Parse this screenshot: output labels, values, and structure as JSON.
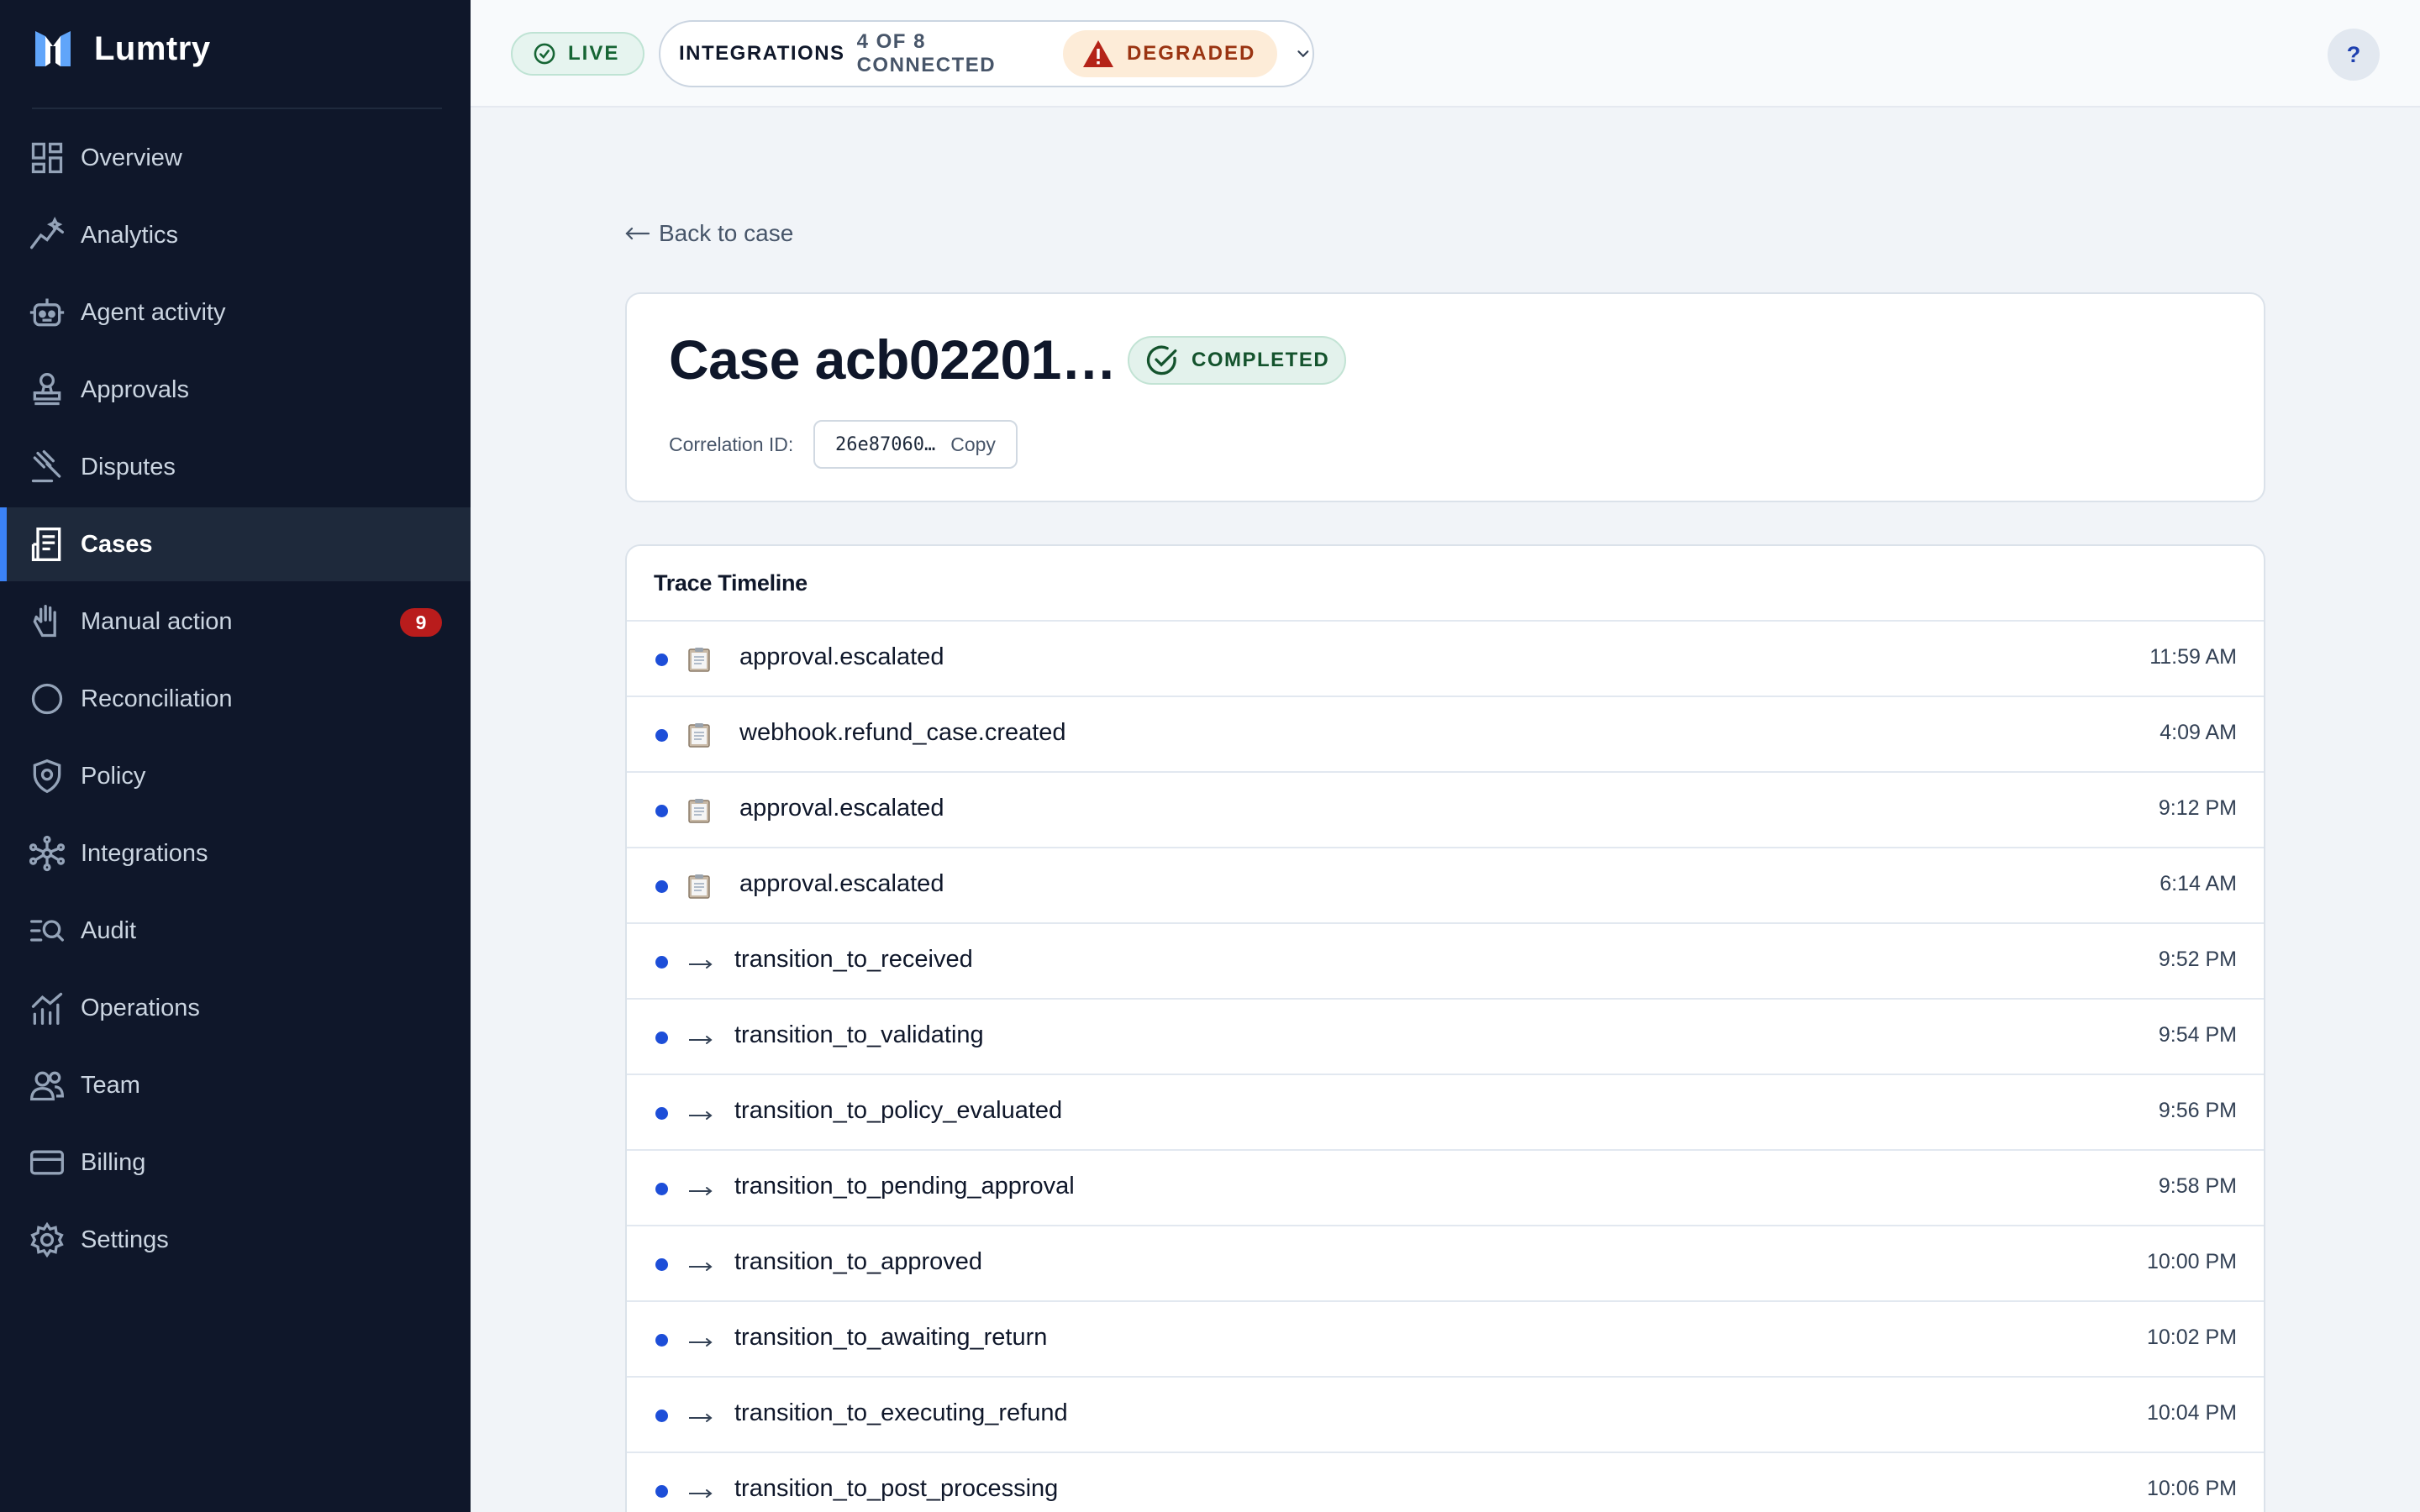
{
  "app": {
    "name": "Lumtry",
    "colors": {
      "sidebar_bg": "#0f172a",
      "accent": "#3b82f6",
      "badge_red": "#b91c1c",
      "success": "#166534",
      "warning": "#9a3412"
    }
  },
  "sidebar": {
    "items": [
      {
        "label": "Overview",
        "icon": "grid-icon"
      },
      {
        "label": "Analytics",
        "icon": "analytics-icon"
      },
      {
        "label": "Agent activity",
        "icon": "robot-icon"
      },
      {
        "label": "Approvals",
        "icon": "stamp-icon"
      },
      {
        "label": "Disputes",
        "icon": "gavel-icon"
      },
      {
        "label": "Cases",
        "icon": "receipt-icon",
        "active": true
      },
      {
        "label": "Manual action",
        "icon": "hand-icon",
        "badge": "9"
      },
      {
        "label": "Reconciliation",
        "icon": "circle-icon"
      },
      {
        "label": "Policy",
        "icon": "shield-icon"
      },
      {
        "label": "Integrations",
        "icon": "network-icon"
      },
      {
        "label": "Audit",
        "icon": "search-list-icon"
      },
      {
        "label": "Operations",
        "icon": "chart-icon"
      },
      {
        "label": "Team",
        "icon": "users-icon"
      },
      {
        "label": "Billing",
        "icon": "card-icon"
      },
      {
        "label": "Settings",
        "icon": "gear-icon"
      }
    ]
  },
  "topbar": {
    "live_label": "LIVE",
    "integrations_label": "INTEGRATIONS",
    "integrations_count": "4 OF 8 CONNECTED",
    "status_label": "DEGRADED",
    "help_label": "?"
  },
  "page": {
    "back_label": "Back to case",
    "case_title": "Case acb02201…",
    "status_badge": "COMPLETED",
    "correlation_label": "Correlation ID:",
    "correlation_value": "26e87060…",
    "copy_label": "Copy"
  },
  "timeline": {
    "title": "Trace Timeline",
    "events": [
      {
        "label": "approval.escalated",
        "time": "11:59 AM",
        "kind": "document"
      },
      {
        "label": "webhook.refund_case.created",
        "time": "4:09 AM",
        "kind": "document"
      },
      {
        "label": "approval.escalated",
        "time": "9:12 PM",
        "kind": "document"
      },
      {
        "label": "approval.escalated",
        "time": "6:14 AM",
        "kind": "document"
      },
      {
        "label": "transition_to_received",
        "time": "9:52 PM",
        "kind": "transition"
      },
      {
        "label": "transition_to_validating",
        "time": "9:54 PM",
        "kind": "transition"
      },
      {
        "label": "transition_to_policy_evaluated",
        "time": "9:56 PM",
        "kind": "transition"
      },
      {
        "label": "transition_to_pending_approval",
        "time": "9:58 PM",
        "kind": "transition"
      },
      {
        "label": "transition_to_approved",
        "time": "10:00 PM",
        "kind": "transition"
      },
      {
        "label": "transition_to_awaiting_return",
        "time": "10:02 PM",
        "kind": "transition"
      },
      {
        "label": "transition_to_executing_refund",
        "time": "10:04 PM",
        "kind": "transition"
      },
      {
        "label": "transition_to_post_processing",
        "time": "10:06 PM",
        "kind": "transition"
      }
    ]
  }
}
